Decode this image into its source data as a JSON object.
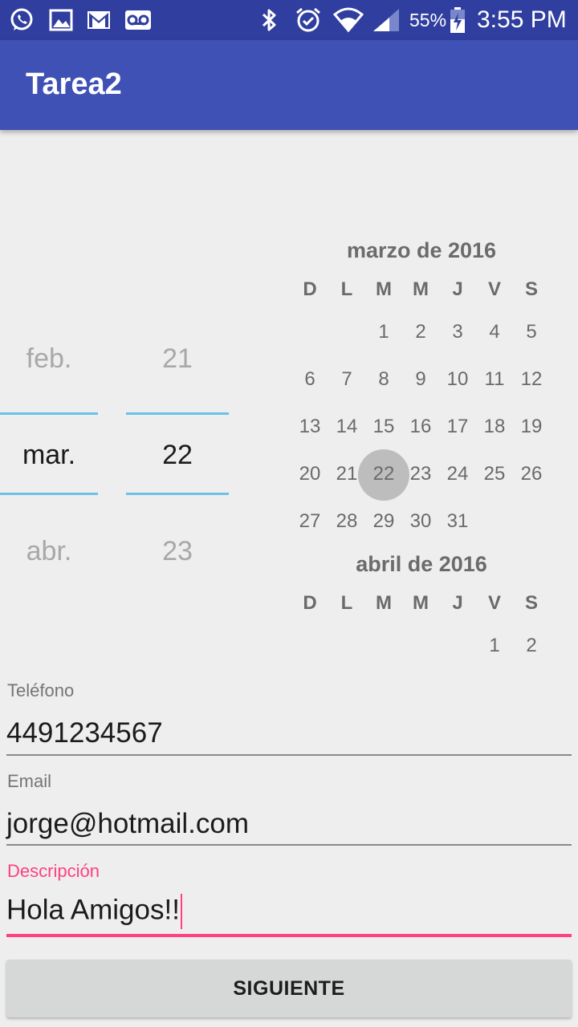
{
  "status_bar": {
    "icons_left": [
      "whatsapp-icon",
      "image-icon",
      "gmail-icon",
      "voicemail-icon"
    ],
    "icons_right": [
      "bluetooth-icon",
      "alarm-icon",
      "wifi-icon",
      "signal-icon",
      "battery-icon"
    ],
    "battery_percent": "55%",
    "time": "3:55 PM"
  },
  "app_bar": {
    "title": "Tarea2"
  },
  "date_spinner": {
    "months": [
      "feb.",
      "mar.",
      "abr."
    ],
    "days": [
      "21",
      "22",
      "23"
    ]
  },
  "calendar": {
    "march": {
      "title": "marzo de 2016",
      "weekdays": [
        "D",
        "L",
        "M",
        "M",
        "J",
        "V",
        "S"
      ],
      "weeks": [
        [
          "",
          "",
          "1",
          "2",
          "3",
          "4",
          "5"
        ],
        [
          "6",
          "7",
          "8",
          "9",
          "10",
          "11",
          "12"
        ],
        [
          "13",
          "14",
          "15",
          "16",
          "17",
          "18",
          "19"
        ],
        [
          "20",
          "21",
          "22",
          "23",
          "24",
          "25",
          "26"
        ],
        [
          "27",
          "28",
          "29",
          "30",
          "31",
          "",
          ""
        ]
      ],
      "selected_day": "22"
    },
    "april": {
      "title": "abril de 2016",
      "weekdays": [
        "D",
        "L",
        "M",
        "M",
        "J",
        "V",
        "S"
      ],
      "weeks": [
        [
          "",
          "",
          "",
          "",
          "",
          "1",
          "2"
        ]
      ]
    }
  },
  "form": {
    "phone": {
      "label": "Teléfono",
      "value": "4491234567"
    },
    "email": {
      "label": "Email",
      "value": "jorge@hotmail.com"
    },
    "description": {
      "label": "Descripción",
      "value": "Hola Amigos!!"
    },
    "accent_color": "#ff4081"
  },
  "next_button": {
    "label": "SIGUIENTE"
  },
  "colors": {
    "status_bar": "#303f9f",
    "app_bar": "#3f51b5",
    "spinner_divider": "#6ac3e6"
  }
}
